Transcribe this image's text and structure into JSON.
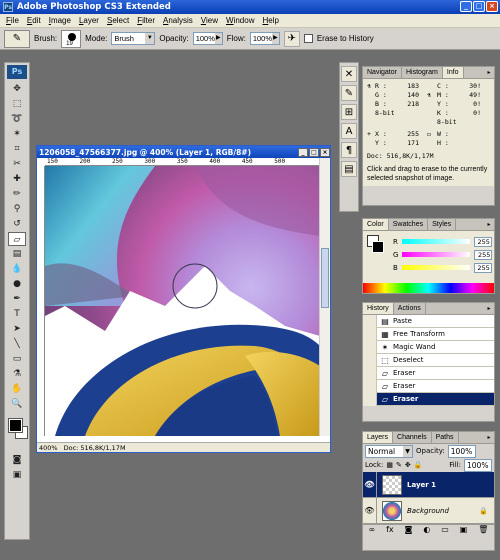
{
  "app": {
    "title": "Adobe Photoshop CS3 Extended",
    "logo": "Ps"
  },
  "window_controls": [
    "_",
    "□",
    "×"
  ],
  "menu": [
    "File",
    "Edit",
    "Image",
    "Layer",
    "Select",
    "Filter",
    "Analysis",
    "View",
    "Window",
    "Help"
  ],
  "options": {
    "brush_label": "Brush:",
    "brush_size": "19",
    "mode_label": "Mode:",
    "mode_value": "Brush",
    "opacity_label": "Opacity:",
    "opacity_value": "100%",
    "flow_label": "Flow:",
    "flow_value": "100%",
    "erase_history_label": "Erase to History"
  },
  "toolbox": {
    "badge": "Ps",
    "tools": [
      "move-tool",
      "marquee-tool",
      "lasso-tool",
      "magic-wand-tool",
      "crop-tool",
      "slice-tool",
      "healing-brush-tool",
      "brush-tool",
      "clone-stamp-tool",
      "history-brush-tool",
      "eraser-tool",
      "gradient-tool",
      "blur-tool",
      "dodge-tool",
      "pen-tool",
      "type-tool",
      "path-selection-tool",
      "shape-tool",
      "notes-tool",
      "eyedropper-tool",
      "hand-tool",
      "zoom-tool"
    ]
  },
  "document": {
    "title": "1206058_47566377.jpg @ 400% (Layer 1, RGB/8#)",
    "ruler_ticks": [
      "150",
      "200",
      "250",
      "300",
      "350",
      "400",
      "450",
      "500"
    ],
    "zoom": "400%",
    "doc_size": "Doc: 516,8K/1,17M"
  },
  "info_panel": {
    "tabs": [
      "Navigator",
      "Histogram",
      "Info"
    ],
    "r_label": "R :",
    "r_value": "183",
    "g_label": "G :",
    "g_value": "140",
    "b_label": "B :",
    "b_value": "218",
    "bit_left": "8-bit",
    "c_label": "C :",
    "c_value": "30!",
    "m_label": "M :",
    "m_value": "49!",
    "y_label": "Y :",
    "y_value": "0!",
    "k_label": "K :",
    "k_value": "0!",
    "bit_right": "8-bit",
    "x_label": "X :",
    "x_value": "255",
    "yy_label": "Y :",
    "yy_value": "171",
    "w_label": "W :",
    "h_label": "H :",
    "doc": "Doc: 516,8K/1,17M",
    "hint": "Click and drag to erase to the currently selected snapshot of image."
  },
  "color_panel": {
    "tabs": [
      "Color",
      "Swatches",
      "Styles"
    ],
    "channels": [
      {
        "label": "R",
        "value": "255",
        "gradient": "#00ffff"
      },
      {
        "label": "G",
        "value": "255",
        "gradient": "#ff00ff"
      },
      {
        "label": "B",
        "value": "255",
        "gradient": "#ffff00"
      }
    ]
  },
  "history_panel": {
    "tabs": [
      "History",
      "Actions"
    ],
    "items": [
      "Paste",
      "Free Transform",
      "Magic Wand",
      "Deselect",
      "Eraser",
      "Eraser",
      "Eraser"
    ],
    "selected_index": 6
  },
  "layers_panel": {
    "tabs": [
      "Layers",
      "Channels",
      "Paths"
    ],
    "blend_mode": "Normal",
    "opacity_label": "Opacity:",
    "opacity_value": "100%",
    "lock_label": "Lock:",
    "fill_label": "Fill:",
    "fill_value": "100%",
    "layers": [
      {
        "name": "Layer 1",
        "selected": true
      },
      {
        "name": "Background",
        "selected": false
      }
    ]
  }
}
